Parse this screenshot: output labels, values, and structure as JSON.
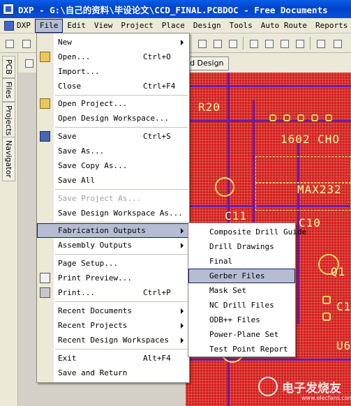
{
  "window": {
    "title": "DXP - G:\\自己的资料\\毕设论文\\CCD_FINAL.PCBDOC - Free Documents"
  },
  "menubar": {
    "items": [
      "DXP",
      "File",
      "Edit",
      "View",
      "Project",
      "Place",
      "Design",
      "Tools",
      "Auto Route",
      "Reports"
    ],
    "active": "File"
  },
  "document_tab": "ard Design",
  "side_tabs": [
    "PCB",
    "Files",
    "Projects",
    "Navigator"
  ],
  "pcb": {
    "labels": [
      "R20",
      "1602 CHO",
      "MAX232",
      "C11",
      "C10",
      "Q1",
      "C1",
      "U6"
    ]
  },
  "file_menu": {
    "items": [
      {
        "label": "New",
        "shortcut": "",
        "submenu": true,
        "disabled": false
      },
      {
        "label": "Open...",
        "shortcut": "Ctrl+O",
        "submenu": false,
        "disabled": false
      },
      {
        "label": "Import...",
        "shortcut": "",
        "submenu": false,
        "disabled": false
      },
      {
        "label": "Close",
        "shortcut": "Ctrl+F4",
        "submenu": false,
        "disabled": false
      },
      {
        "label": "Open Project...",
        "shortcut": "",
        "submenu": false,
        "disabled": false
      },
      {
        "label": "Open Design Workspace...",
        "shortcut": "",
        "submenu": false,
        "disabled": false
      },
      {
        "label": "Save",
        "shortcut": "Ctrl+S",
        "submenu": false,
        "disabled": false
      },
      {
        "label": "Save As...",
        "shortcut": "",
        "submenu": false,
        "disabled": false
      },
      {
        "label": "Save Copy As...",
        "shortcut": "",
        "submenu": false,
        "disabled": false
      },
      {
        "label": "Save All",
        "shortcut": "",
        "submenu": false,
        "disabled": false
      },
      {
        "label": "Save Project As...",
        "shortcut": "",
        "submenu": false,
        "disabled": true
      },
      {
        "label": "Save Design Workspace As...",
        "shortcut": "",
        "submenu": false,
        "disabled": false
      },
      {
        "label": "Fabrication Outputs",
        "shortcut": "",
        "submenu": true,
        "disabled": false
      },
      {
        "label": "Assembly Outputs",
        "shortcut": "",
        "submenu": true,
        "disabled": false
      },
      {
        "label": "Page Setup...",
        "shortcut": "",
        "submenu": false,
        "disabled": false
      },
      {
        "label": "Print Preview...",
        "shortcut": "",
        "submenu": false,
        "disabled": false
      },
      {
        "label": "Print...",
        "shortcut": "Ctrl+P",
        "submenu": false,
        "disabled": false
      },
      {
        "label": "Recent Documents",
        "shortcut": "",
        "submenu": true,
        "disabled": false
      },
      {
        "label": "Recent Projects",
        "shortcut": "",
        "submenu": true,
        "disabled": false
      },
      {
        "label": "Recent Design Workspaces",
        "shortcut": "",
        "submenu": true,
        "disabled": false
      },
      {
        "label": "Exit",
        "shortcut": "Alt+F4",
        "submenu": false,
        "disabled": false
      },
      {
        "label": "Save and Return",
        "shortcut": "",
        "submenu": false,
        "disabled": false
      }
    ],
    "highlighted": "Fabrication Outputs"
  },
  "fabrication_submenu": {
    "items": [
      "Composite Drill Guide",
      "Drill Drawings",
      "Final",
      "Gerber Files",
      "Mask Set",
      "NC Drill Files",
      "ODB++ Files",
      "Power-Plane Set",
      "Test Point Report"
    ],
    "highlighted": "Gerber Files"
  },
  "watermark": {
    "text": "电子发烧友",
    "subtext": "www.elecfans.com"
  },
  "colors": {
    "highlight": "#b6bdd2",
    "pcb_background": "#d4201c",
    "menu_bar": "#ece9d8",
    "title_bar": "#0a4fd8"
  }
}
